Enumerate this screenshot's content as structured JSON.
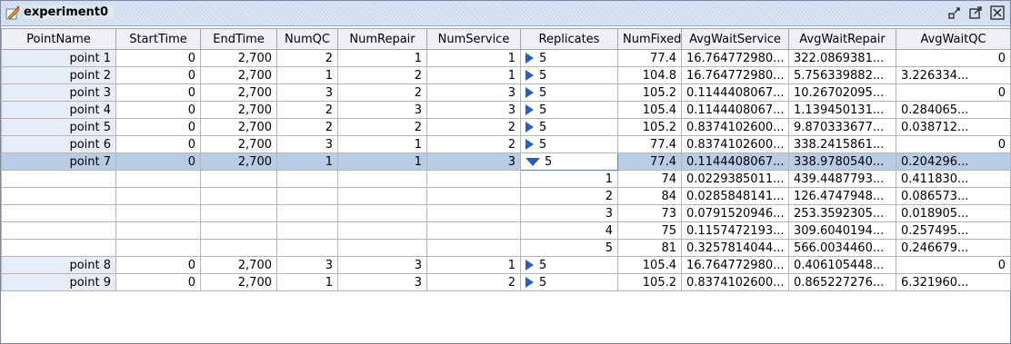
{
  "window": {
    "title": "experiment0"
  },
  "colors": {
    "highlight_header": "#f7f700",
    "pink_header": "#f4d8e2",
    "selected_row": "#b9cce6",
    "expander": "#2d5fae"
  },
  "icons": {
    "title": "experiment-icon",
    "minimize": "restore-down-icon",
    "maximize": "maximize-icon",
    "close": "close-icon"
  },
  "columns": [
    "PointName",
    "StartTime",
    "EndTime",
    "NumQC",
    "NumRepair",
    "NumService",
    "Replicates",
    "NumFixed",
    "AvgWaitService",
    "AvgWaitRepair",
    "AvgWaitQC"
  ],
  "rows": [
    {
      "name": "point 1",
      "start": "0",
      "end": "2,700",
      "qc": "2",
      "repair": "1",
      "service": "1",
      "rep": "5",
      "fixed": "77.4",
      "ws": "16.764772980...",
      "wr": "322.0869381...",
      "wq": "0"
    },
    {
      "name": "point 2",
      "start": "0",
      "end": "2,700",
      "qc": "1",
      "repair": "2",
      "service": "1",
      "rep": "5",
      "fixed": "104.8",
      "ws": "16.764772980...",
      "wr": "5.756339882...",
      "wq": "3.226334..."
    },
    {
      "name": "point 3",
      "start": "0",
      "end": "2,700",
      "qc": "3",
      "repair": "2",
      "service": "3",
      "rep": "5",
      "fixed": "105.2",
      "ws": "0.1144408067...",
      "wr": "10.26702095...",
      "wq": "0"
    },
    {
      "name": "point 4",
      "start": "0",
      "end": "2,700",
      "qc": "2",
      "repair": "3",
      "service": "3",
      "rep": "5",
      "fixed": "105.4",
      "ws": "0.1144408067...",
      "wr": "1.139450131...",
      "wq": "0.284065..."
    },
    {
      "name": "point 5",
      "start": "0",
      "end": "2,700",
      "qc": "2",
      "repair": "2",
      "service": "2",
      "rep": "5",
      "fixed": "105.2",
      "ws": "0.8374102600...",
      "wr": "9.870333677...",
      "wq": "0.038712..."
    },
    {
      "name": "point 6",
      "start": "0",
      "end": "2,700",
      "qc": "3",
      "repair": "1",
      "service": "2",
      "rep": "5",
      "fixed": "77.4",
      "ws": "0.8374102600...",
      "wr": "338.2415861...",
      "wq": "0"
    },
    {
      "name": "point 7",
      "start": "0",
      "end": "2,700",
      "qc": "1",
      "repair": "1",
      "service": "3",
      "rep": "5",
      "fixed": "77.4",
      "ws": "0.1144408067...",
      "wr": "338.9780540...",
      "wq": "0.204296..."
    }
  ],
  "replicates": [
    {
      "idx": "1",
      "fixed": "74",
      "ws": "0.0229385011...",
      "wr": "439.4487793...",
      "wq": "0.411830..."
    },
    {
      "idx": "2",
      "fixed": "84",
      "ws": "0.0285848141...",
      "wr": "126.4747948...",
      "wq": "0.086573..."
    },
    {
      "idx": "3",
      "fixed": "73",
      "ws": "0.0791520946...",
      "wr": "253.3592305...",
      "wq": "0.018905..."
    },
    {
      "idx": "4",
      "fixed": "75",
      "ws": "0.1157472193...",
      "wr": "309.6040194...",
      "wq": "0.257495..."
    },
    {
      "idx": "5",
      "fixed": "81",
      "ws": "0.3257814044...",
      "wr": "566.0034460...",
      "wq": "0.246679..."
    }
  ],
  "rows_after": [
    {
      "name": "point 8",
      "start": "0",
      "end": "2,700",
      "qc": "3",
      "repair": "3",
      "service": "1",
      "rep": "5",
      "fixed": "105.4",
      "ws": "16.764772980...",
      "wr": "0.406105448...",
      "wq": "0"
    },
    {
      "name": "point 9",
      "start": "0",
      "end": "2,700",
      "qc": "1",
      "repair": "3",
      "service": "2",
      "rep": "5",
      "fixed": "105.2",
      "ws": "0.8374102600...",
      "wr": "0.865227276...",
      "wq": "6.321960..."
    }
  ]
}
